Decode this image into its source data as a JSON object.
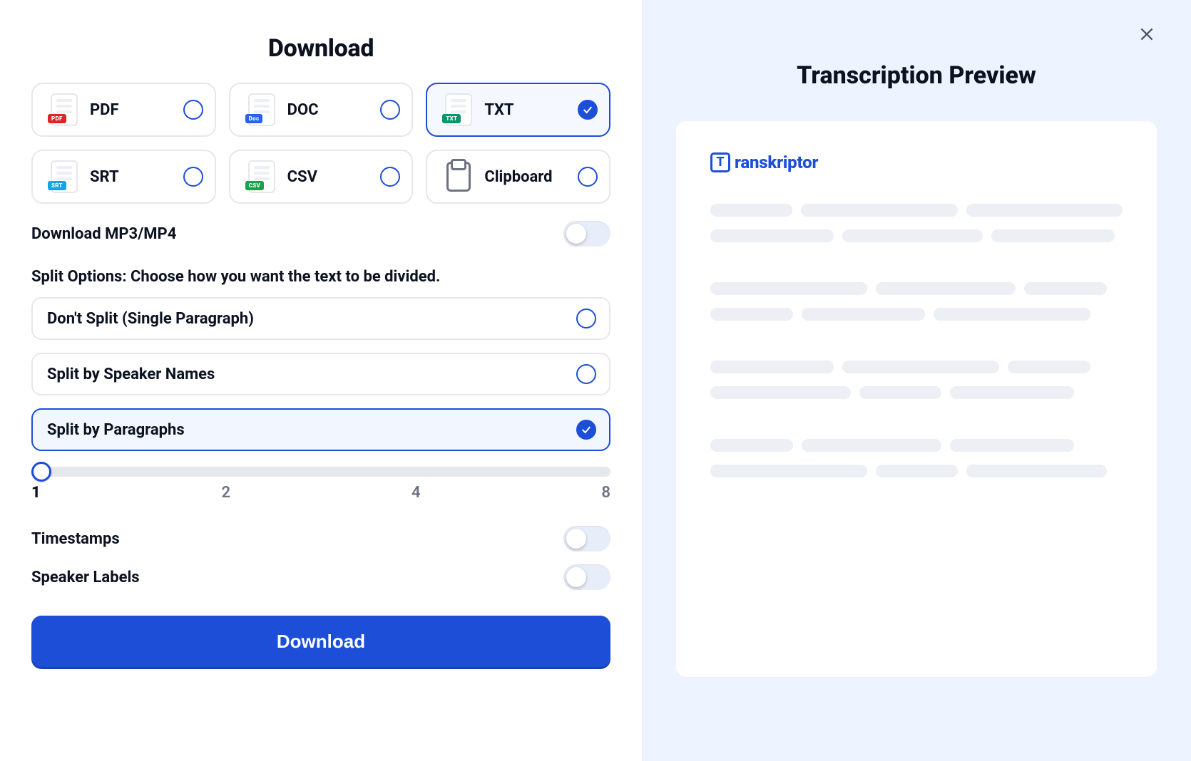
{
  "header": {
    "title": "Download"
  },
  "formats": [
    {
      "id": "pdf",
      "label": "PDF",
      "tag": "PDF",
      "tagClass": "tag-pdf",
      "selected": false
    },
    {
      "id": "doc",
      "label": "DOC",
      "tag": "Doc",
      "tagClass": "tag-doc",
      "selected": false
    },
    {
      "id": "txt",
      "label": "TXT",
      "tag": "TXT",
      "tagClass": "tag-txt",
      "selected": true
    },
    {
      "id": "srt",
      "label": "SRT",
      "tag": "SRT",
      "tagClass": "tag-srt",
      "selected": false
    },
    {
      "id": "csv",
      "label": "CSV",
      "tag": "CSV",
      "tagClass": "tag-csv",
      "selected": false
    },
    {
      "id": "clip",
      "label": "Clipboard",
      "clipboard": true,
      "selected": false
    }
  ],
  "toggles": {
    "mp3mp4": {
      "label": "Download MP3/MP4",
      "on": false
    },
    "timestamps": {
      "label": "Timestamps",
      "on": false
    },
    "speakerLabels": {
      "label": "Speaker Labels",
      "on": false
    }
  },
  "split": {
    "label": "Split Options: Choose how you want the text to be divided.",
    "options": [
      {
        "id": "none",
        "label": "Don't Split (Single Paragraph)",
        "selected": false
      },
      {
        "id": "speakers",
        "label": "Split by Speaker Names",
        "selected": false
      },
      {
        "id": "paras",
        "label": "Split by Paragraphs",
        "selected": true
      }
    ],
    "slider": {
      "value": 1,
      "ticks": [
        "1",
        "2",
        "4",
        "8"
      ]
    }
  },
  "cta": {
    "label": "Download"
  },
  "preview": {
    "title": "Transcription Preview",
    "logoLetter": "T",
    "logoRest": "ranskriptor"
  }
}
